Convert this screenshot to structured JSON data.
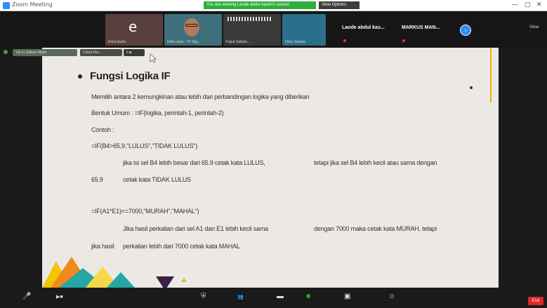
{
  "window": {
    "title": "Zoom Meeting",
    "banner_text": "You are viewing Laode abdul kasim's screen",
    "banner_button": "View Options",
    "controls": [
      "—",
      "▢",
      "✕"
    ]
  },
  "gallery": {
    "tiles": [
      {
        "letter": "e",
        "name": "Enna Eufra"
      },
      {
        "name": "Indra Jaya - Tri Yog..."
      },
      {
        "name": "Fajrul Salmet..."
      },
      {
        "name": "Fitria Sukses"
      }
    ],
    "names": [
      "Laode abdul kas...",
      "MARKUS MAN..."
    ],
    "view_label": "View"
  },
  "share_bar": {
    "pill1": "Tyk in Gallery Mode",
    "pill2": "Cloud Rec...",
    "pill3": "II ■"
  },
  "slide": {
    "heading": "Fungsi Logika IF",
    "lines": [
      "Memilih antara 2 kemungkinan atau lebih dari perbandingan logika yang diberikan",
      "Bentuk Umum : =IF(logika, perintah-1, perintah-2)",
      "Contoh :",
      "=IF(B4>65,9,\"LULUS\",\"TIDAK LULUS\")",
      "jika isi sel B4 lebih besar dari 65.9 cetak kata LULUS,",
      "tetapi jika sel B4 lebih kecil atau sama dengan",
      "65.9",
      "cetak kata TIDAK LULUS",
      "=IF(A1*E1)<=7000,\"MURAH\",\"MAHAL\")",
      "Jika hasil perkalian dari sel A1 dan E1 lebih kecil sama",
      "dengan 7000 maka cetak kata MURAH, tetapi",
      "jika hasil",
      "perkalian lebih dari 7000 cetak kata MAHAL"
    ],
    "colors": {
      "accent_line": "#f0b400",
      "tri_yellow": "#f2c500",
      "tri_teal": "#27a6a6",
      "tri_orange": "#ef8a1c",
      "tri_purple": "#3b1f4a",
      "tri_green": "#b7cc3a"
    }
  },
  "toolbar": {
    "items": [
      "mic-icon",
      "video-icon",
      "security-icon",
      "participants-icon",
      "chat-icon",
      "share-screen-icon",
      "record-icon",
      "reactions-icon"
    ],
    "end_label": "End"
  }
}
